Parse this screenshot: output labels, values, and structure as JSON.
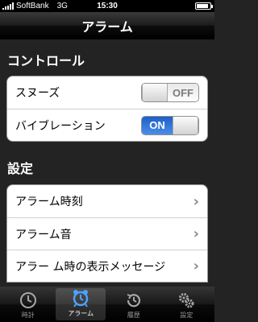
{
  "status_bar": {
    "carrier": "SoftBank",
    "network": "3G",
    "time": "15:30",
    "battery_level": 0.9
  },
  "nav": {
    "title": "アラーム"
  },
  "controls": {
    "header": "コントロール",
    "snooze": {
      "label": "スヌーズ",
      "state": "OFF"
    },
    "vibration": {
      "label": "バイブレーション",
      "state": "ON"
    }
  },
  "settings": {
    "header": "設定",
    "items": [
      {
        "label": "アラーム時刻"
      },
      {
        "label": "アラーム音"
      },
      {
        "label": "アラー ム時の表示メッセージ"
      }
    ]
  },
  "tabs": [
    {
      "label": "時計",
      "icon": "clock-icon",
      "active": false
    },
    {
      "label": "アラーム",
      "icon": "alarm-clock-icon",
      "active": true
    },
    {
      "label": "履歴",
      "icon": "history-icon",
      "active": false
    },
    {
      "label": "設定",
      "icon": "gears-icon",
      "active": false
    }
  ],
  "colors": {
    "background": "#232323",
    "toggle_on": "#2f72d8",
    "chevron": "#8a8a8a"
  }
}
